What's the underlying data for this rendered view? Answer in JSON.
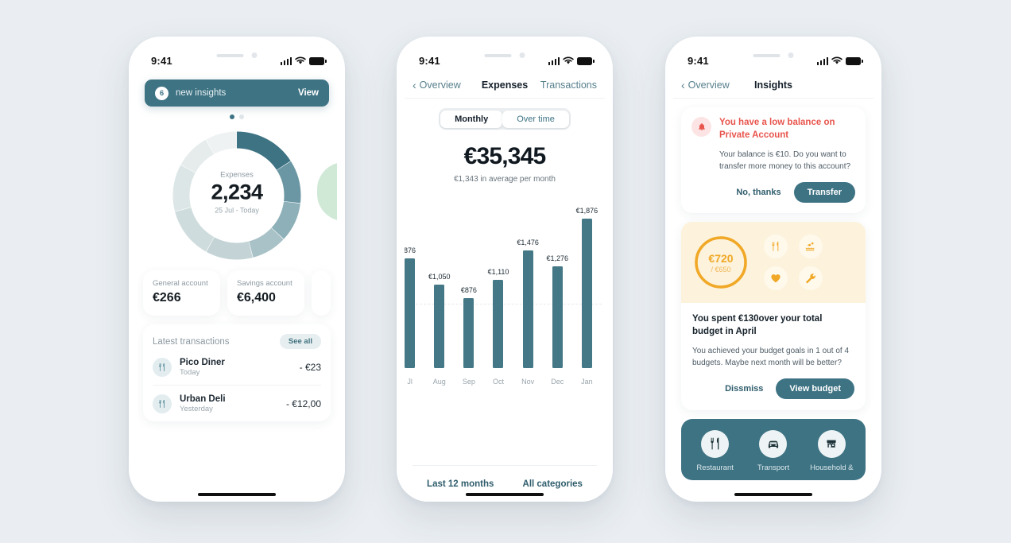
{
  "theme": {
    "page_bg": "#eaeef2",
    "teal": "#3e7384",
    "bar_teal": "#447886",
    "orange": "#f0a826",
    "red": "#e8554d",
    "cream": "#fdf2db"
  },
  "status_bar": {
    "time": "9:41",
    "signal_icon": "signal-bars-icon",
    "wifi_icon": "wifi-icon",
    "battery_icon": "battery-icon"
  },
  "phone1": {
    "banner": {
      "count": "6",
      "text": "new insights",
      "action": "View"
    },
    "carousel": {
      "total": 2,
      "active": 0
    },
    "donut": {
      "center_label": "Expenses",
      "center_value": "2,234",
      "center_range": "25 Jul - Today",
      "segments": [
        {
          "name": "segment-1",
          "percent": 16,
          "color": "#3e7384"
        },
        {
          "name": "segment-2",
          "percent": 11,
          "color": "#6a97a3"
        },
        {
          "name": "segment-3",
          "percent": 10,
          "color": "#8db0b9"
        },
        {
          "name": "segment-4",
          "percent": 9,
          "color": "#a9c2c7"
        },
        {
          "name": "segment-5",
          "percent": 12,
          "color": "#c3d3d6"
        },
        {
          "name": "segment-6",
          "percent": 13,
          "color": "#cfdcdd"
        },
        {
          "name": "segment-7",
          "percent": 12,
          "color": "#dde6e6"
        },
        {
          "name": "segment-8",
          "percent": 9,
          "color": "#e6ecec"
        },
        {
          "name": "segment-9",
          "percent": 8,
          "color": "#eff2f2"
        }
      ]
    },
    "accounts": [
      {
        "label": "General account",
        "value": "€266"
      },
      {
        "label": "Savings account",
        "value": "€6,400"
      }
    ],
    "transactions_card": {
      "title": "Latest transactions",
      "see_all": "See all",
      "rows": [
        {
          "icon": "restaurant-icon",
          "name": "Pico Diner",
          "sub": "Today",
          "amount": "- €23"
        },
        {
          "icon": "restaurant-icon",
          "name": "Urban Deli",
          "sub": "Yesterday",
          "amount": "- €12,00"
        }
      ]
    }
  },
  "phone2": {
    "nav": {
      "back": "Overview",
      "title": "Expenses",
      "right": "Transactions"
    },
    "segmented": {
      "options": [
        "Monthly",
        "Over time"
      ],
      "selected": "Monthly"
    },
    "total": "€35,345",
    "average": "€1,343 in average per month",
    "footer": {
      "left": "Last 12 months",
      "right": "All categories"
    },
    "chart_data": {
      "type": "bar",
      "title": "Expenses over time",
      "categories": [
        "Jul",
        "Aug",
        "Sep",
        "Oct",
        "Nov",
        "Dec",
        "Jan"
      ],
      "tick_labels": [
        "Jl",
        "Aug",
        "Sep",
        "Oct",
        "Nov",
        "Dec",
        "Jan"
      ],
      "values": [
        1376,
        1050,
        876,
        1110,
        1476,
        1276,
        1876
      ],
      "data_labels": [
        "876",
        "€1,050",
        "€876",
        "€1,110",
        "€1,476",
        "€1,276",
        "€1,876"
      ],
      "xlabel": "",
      "ylabel": "",
      "ylim": [
        0,
        2000
      ],
      "grid": true,
      "gridlines": [
        876
      ],
      "legend": "none",
      "series_color": "#447886"
    }
  },
  "phone3": {
    "nav": {
      "back": "Overview",
      "title": "Insights"
    },
    "alert": {
      "icon": "bell-icon",
      "title": "You have a low balance on Private Account",
      "body": "Your balance is €10. Do you want to transfer more money to this account?",
      "secondary": "No, thanks",
      "primary": "Transfer"
    },
    "budget": {
      "ring_value": "€720",
      "ring_limit": "/ €650",
      "ring_percent": 100,
      "categories": [
        "restaurant-icon",
        "pool-icon",
        "heart-icon",
        "wrench-icon"
      ],
      "title": "You spent €130over your total budget in April",
      "body": "You achieved your budget goals in 1 out of 4 budgets. Maybe next month will be better?",
      "secondary": "Dissmiss",
      "primary": "View budget"
    },
    "category_strip": [
      {
        "icon": "restaurant-icon",
        "label": "Restaurant"
      },
      {
        "icon": "car-icon",
        "label": "Transport"
      },
      {
        "icon": "shop-icon",
        "label": "Household &"
      }
    ]
  }
}
